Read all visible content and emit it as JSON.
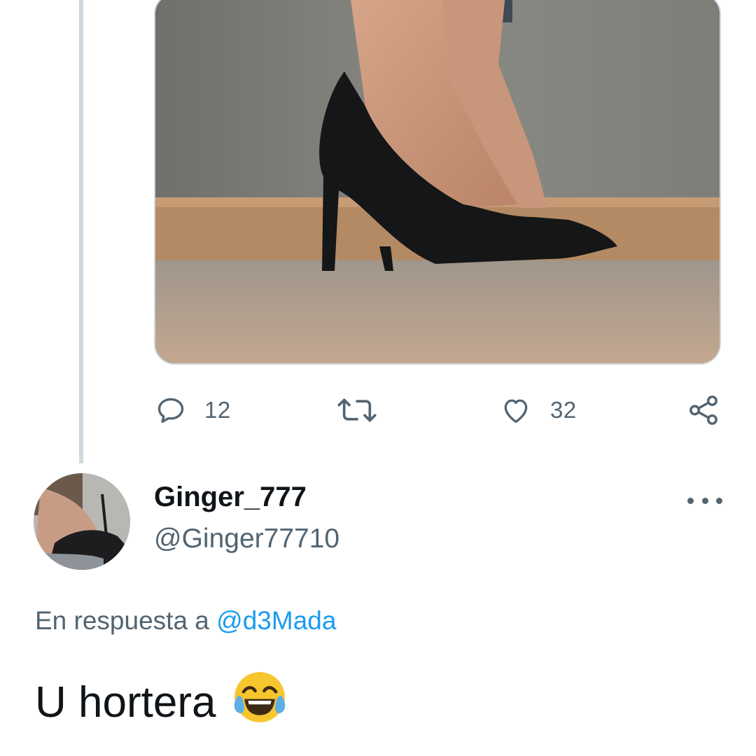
{
  "quoted_tweet": {
    "media_alt": "photo",
    "stats": {
      "replies": "12",
      "retweets": "",
      "likes": "32"
    },
    "icons": {
      "reply": "reply-bubble-icon",
      "retweet": "retweet-icon",
      "like": "heart-icon",
      "share": "share-icon"
    }
  },
  "reply": {
    "display_name": "Ginger_777",
    "handle": "@Ginger77710",
    "reply_prefix": "En respuesta a",
    "reply_mention": "@d3Mada",
    "text": "U hortera",
    "emoji": "face-with-tears-of-joy-icon"
  },
  "colors": {
    "secondary_text": "#536471",
    "primary_text": "#0f1419",
    "link": "#1d9bf0",
    "thread_line": "#cfd9de"
  }
}
